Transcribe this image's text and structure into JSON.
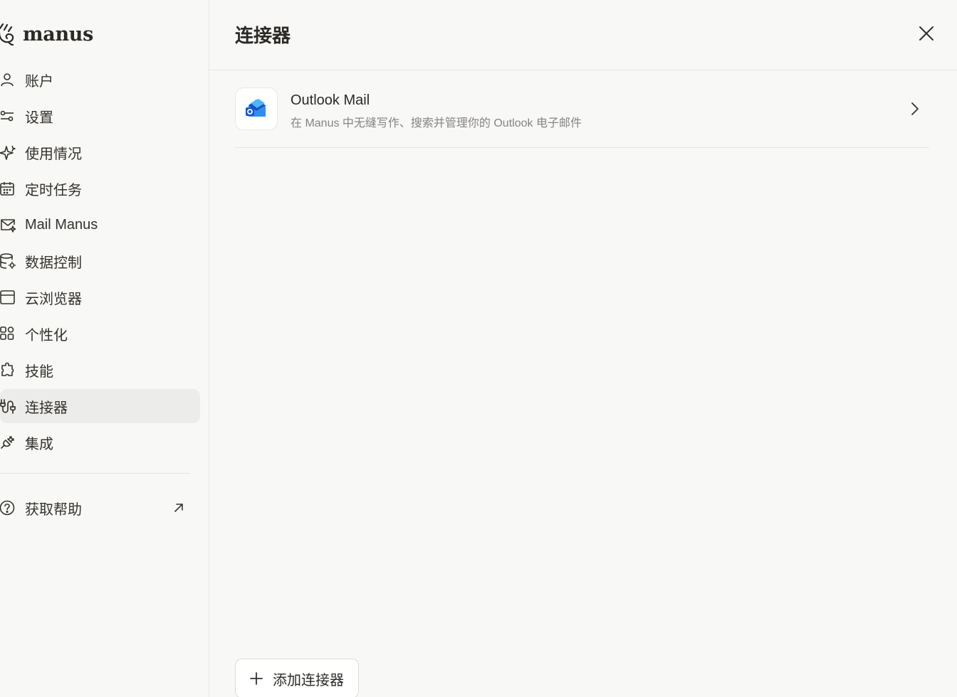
{
  "brand": {
    "name": "manus"
  },
  "sidebar": {
    "items": [
      {
        "label": "账户",
        "icon": "user-icon"
      },
      {
        "label": "设置",
        "icon": "sliders-icon"
      },
      {
        "label": "使用情况",
        "icon": "sparkle-icon"
      },
      {
        "label": "定时任务",
        "icon": "calendar-icon"
      },
      {
        "label": "Mail Manus",
        "icon": "mail-icon"
      },
      {
        "label": "数据控制",
        "icon": "database-gear-icon"
      },
      {
        "label": "云浏览器",
        "icon": "browser-icon"
      },
      {
        "label": "个性化",
        "icon": "grid-icon"
      },
      {
        "label": "技能",
        "icon": "puzzle-icon"
      },
      {
        "label": "连接器",
        "icon": "connector-icon",
        "active": true
      },
      {
        "label": "集成",
        "icon": "plug-icon"
      }
    ],
    "help": {
      "label": "获取帮助",
      "icon": "help-circle-icon"
    }
  },
  "main": {
    "title": "连接器",
    "connectors": [
      {
        "name": "Outlook Mail",
        "description": "在 Manus 中无缝写作、搜索并管理你的 Outlook 电子邮件",
        "icon": "outlook-icon"
      }
    ],
    "add_button": {
      "label": "添加连接器"
    }
  },
  "colors": {
    "background": "#f8f8f7",
    "active_item": "#ececea",
    "text": "#34322d",
    "muted_text": "#858481",
    "outlook_blue": "#1a73e8"
  }
}
